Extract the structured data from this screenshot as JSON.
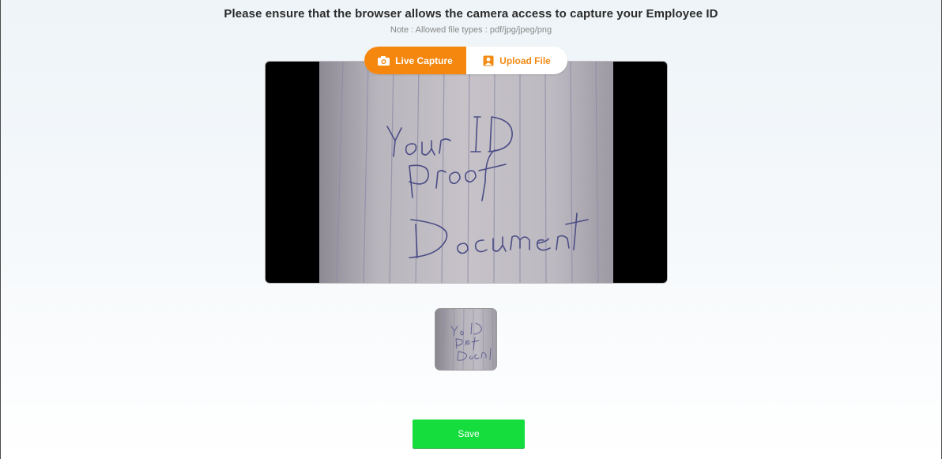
{
  "header": {
    "instruction": "Please ensure that the browser allows the camera access to capture your Employee ID",
    "note": "Note : Allowed file types : pdf/jpg/jpeg/png"
  },
  "tabs": [
    {
      "label": "Live Capture",
      "icon": "camera-icon",
      "active": true
    },
    {
      "label": "Upload File",
      "icon": "person-badge-icon",
      "active": false
    }
  ],
  "capture": {
    "handwritten_text": [
      "Your ID",
      "Proof",
      "Document"
    ]
  },
  "actions": {
    "save_label": "Save"
  },
  "colors": {
    "accent_orange": "#f5870e",
    "save_green": "#15dd3e"
  }
}
